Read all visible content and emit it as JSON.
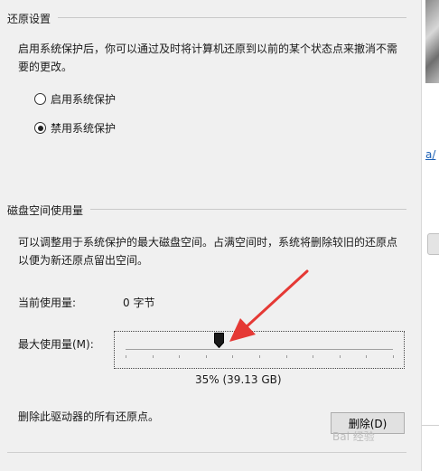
{
  "restore": {
    "title": "还原设置",
    "description": "启用系统保护后，你可以通过及时将计算机还原到以前的某个状态点来撤消不需要的更改。",
    "options": [
      {
        "label": "启用系统保护",
        "selected": false
      },
      {
        "label": "禁用系统保护",
        "selected": true
      }
    ]
  },
  "disk": {
    "title": "磁盘空间使用量",
    "description": "可以调整用于系统保护的最大磁盘空间。占满空间时，系统将删除较旧的还原点以便为新还原点留出空间。",
    "current_label": "当前使用量:",
    "current_value": "0 字节",
    "max_label": "最大使用量(M):",
    "slider_value_percent": 35,
    "slider_value_text": "35% (39.13 GB)"
  },
  "delete": {
    "description": "删除此驱动器的所有还原点。",
    "button_label": "删除(D)"
  },
  "sidebar": {
    "link_text": "a/"
  },
  "watermark": "Bai 经验",
  "colors": {
    "arrow": "#e53935",
    "link": "#1a5fb4"
  }
}
